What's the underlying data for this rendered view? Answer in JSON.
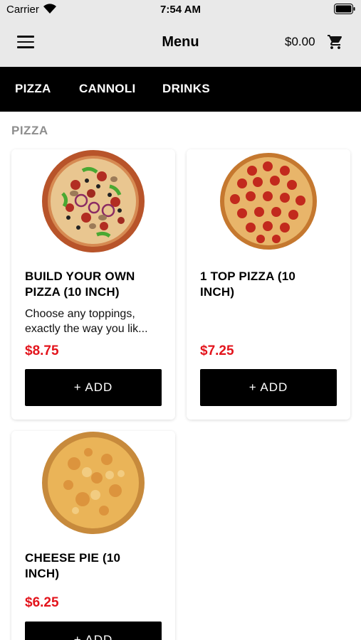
{
  "status_bar": {
    "carrier": "Carrier",
    "time": "7:54 AM"
  },
  "header": {
    "title": "Menu",
    "cart_total": "$0.00"
  },
  "nav": {
    "tabs": [
      "PIZZA",
      "CANNOLI",
      "DRINKS"
    ]
  },
  "section": {
    "title": "PIZZA"
  },
  "products": [
    {
      "name_lines": [
        "BUILD YOUR OWN",
        "PIZZA (10 INCH)"
      ],
      "description_lines": [
        "Choose any toppings,",
        "exactly the way you lik..."
      ],
      "price": "$8.75",
      "add_label": "+ ADD",
      "image": "supreme-pizza-image"
    },
    {
      "name_lines": [
        "1 TOP PIZZA (10",
        "INCH)"
      ],
      "description_lines": [],
      "price": "$7.25",
      "add_label": "+ ADD",
      "image": "pepperoni-pizza-image"
    },
    {
      "name_lines": [
        "CHEESE PIE (10",
        "INCH)"
      ],
      "description_lines": [],
      "price": "$6.25",
      "add_label": "+ ADD",
      "image": "cheese-pizza-image"
    }
  ],
  "colors": {
    "price": "#e3141c",
    "header_bg": "#e9e9e9",
    "nav_bg": "#000000",
    "button_bg": "#000000"
  },
  "icons": {
    "menu": "hamburger-menu-icon",
    "cart": "shopping-cart-icon",
    "wifi": "wifi-icon",
    "battery": "battery-icon"
  }
}
